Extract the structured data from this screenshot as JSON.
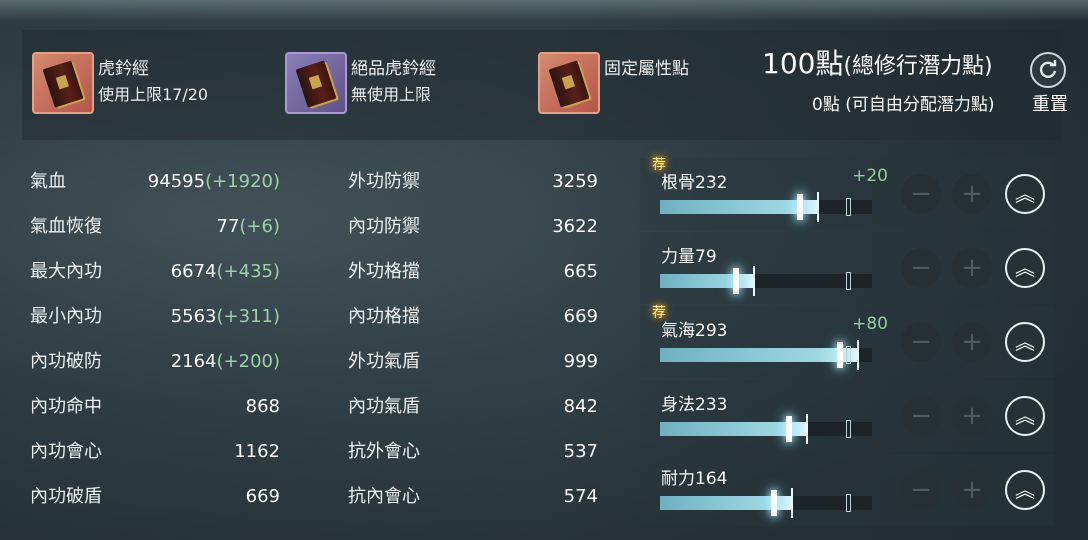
{
  "items": [
    {
      "name": "虎鈐經",
      "sub": "使用上限17/20",
      "icon": "red-book-icon"
    },
    {
      "name": "絕品虎鈐經",
      "sub": "無使用上限",
      "icon": "purple-book-icon"
    },
    {
      "name": "固定屬性點",
      "sub": "",
      "icon": "red-book-icon"
    }
  ],
  "potential": {
    "points": "100點",
    "points_label": "(總修行潛力點)",
    "free": "0點 (可自由分配潛力點)",
    "reset_label": "重置"
  },
  "stats_left": [
    {
      "label": "氣血",
      "value": "94595",
      "bonus": "(+1920)"
    },
    {
      "label": "氣血恢復",
      "value": "77",
      "bonus": "(+6)"
    },
    {
      "label": "最大內功",
      "value": "6674",
      "bonus": "(+435)"
    },
    {
      "label": "最小內功",
      "value": "5563",
      "bonus": "(+311)"
    },
    {
      "label": "內功破防",
      "value": "2164",
      "bonus": "(+200)"
    },
    {
      "label": "內功命中",
      "value": "868",
      "bonus": ""
    },
    {
      "label": "內功會心",
      "value": "1162",
      "bonus": ""
    },
    {
      "label": "內功破盾",
      "value": "669",
      "bonus": ""
    }
  ],
  "stats_right": [
    {
      "label": "外功防禦",
      "value": "3259"
    },
    {
      "label": "內功防禦",
      "value": "3622"
    },
    {
      "label": "外功格擋",
      "value": "665"
    },
    {
      "label": "內功格擋",
      "value": "669"
    },
    {
      "label": "外功氣盾",
      "value": "999"
    },
    {
      "label": "內功氣盾",
      "value": "842"
    },
    {
      "label": "抗外會心",
      "value": "537"
    },
    {
      "label": "抗內會心",
      "value": "574"
    }
  ],
  "attributes": [
    {
      "name": "根骨232",
      "added": "+20",
      "recommended": "荐",
      "fill": 0.74
    },
    {
      "name": "力量79",
      "added": "",
      "recommended": "",
      "fill": 0.44
    },
    {
      "name": "氣海293",
      "added": "+80",
      "recommended": "荐",
      "fill": 0.93
    },
    {
      "name": "身法233",
      "added": "",
      "recommended": "",
      "fill": 0.69
    },
    {
      "name": "耐力164",
      "added": "",
      "recommended": "",
      "fill": 0.62
    }
  ],
  "buttons": {
    "minus": "−",
    "plus": "+",
    "max": "︽"
  },
  "colors": {
    "bonus_green": "#9fd0a8",
    "bar_cyan": "#9ed7e2",
    "recommend_gold": "#ffb000"
  }
}
